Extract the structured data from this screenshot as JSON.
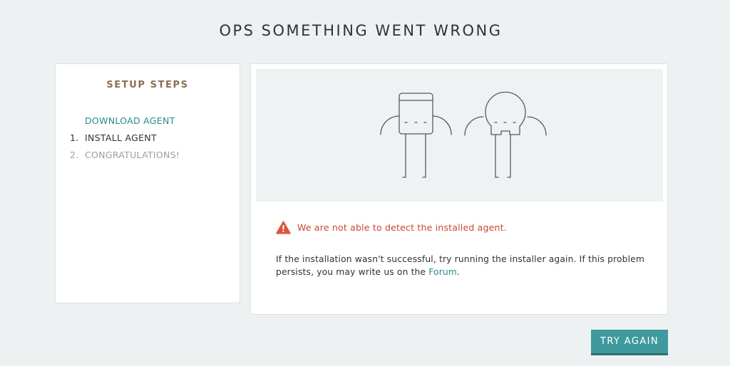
{
  "page": {
    "title": "OPS SOMETHING WENT WRONG"
  },
  "setup_steps": {
    "title": "SETUP STEPS",
    "items": [
      {
        "number": "",
        "label": "DOWNLOAD AGENT",
        "state": "completed"
      },
      {
        "number": "1.",
        "label": "INSTALL AGENT",
        "state": "current"
      },
      {
        "number": "2.",
        "label": "CONGRATULATIONS!",
        "state": "pending"
      }
    ]
  },
  "main": {
    "illustration_icon": "sad-robot-and-skull-figures",
    "error_icon": "warning-triangle-icon",
    "error_message": "We are not able to detect the installed agent.",
    "help_text_before_link": "If the installation wasn't successful, try running the installer again. If this problem persists, you may write us on the ",
    "help_link_label": "Forum",
    "help_text_after_link": "."
  },
  "actions": {
    "try_again_label": "TRY AGAIN"
  },
  "colors": {
    "background": "#eef1f2",
    "accent_teal": "#3e9a9c",
    "link_teal": "#2a8a8e",
    "error_red": "#c9472f",
    "steps_title_brown": "#8b6e4e"
  }
}
